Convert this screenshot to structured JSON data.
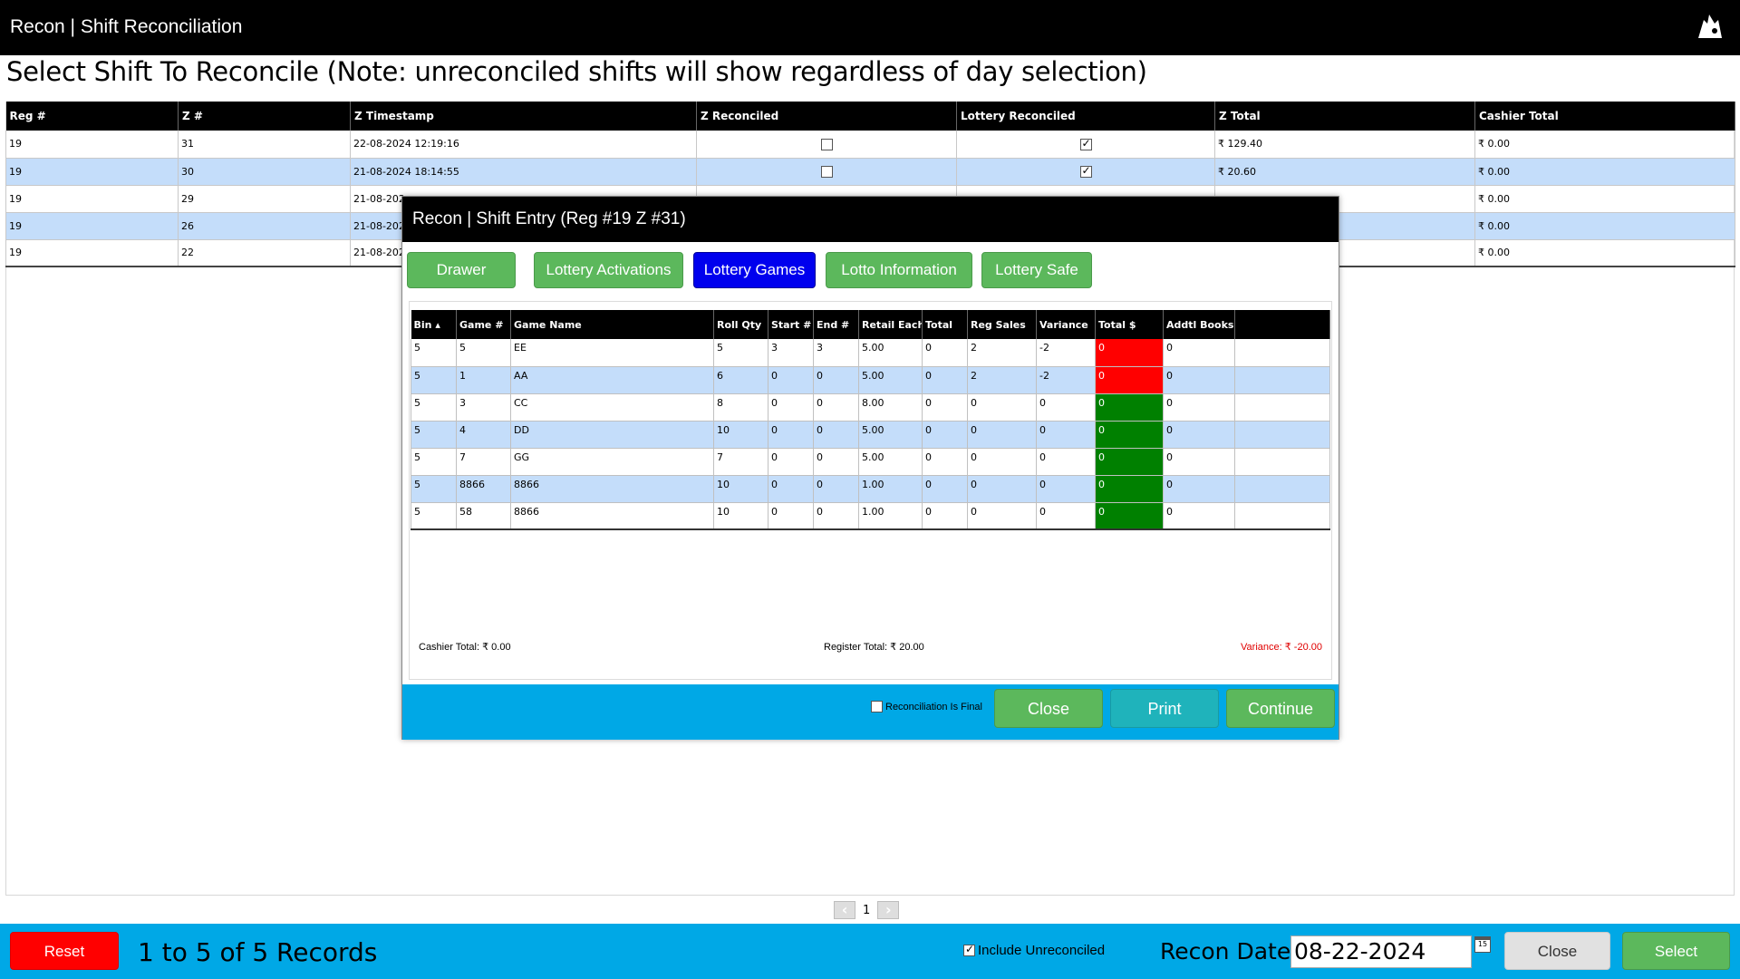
{
  "window": {
    "title": "Recon | Shift Reconciliation",
    "logo_icon": "cap-logo-icon"
  },
  "heading": "Select Shift To Reconcile (Note: unreconciled shifts will show regardless of day selection)",
  "main_table": {
    "headers": [
      "Reg #",
      "Z #",
      "Z Timestamp",
      "Z Reconciled",
      "Lottery Reconciled",
      "Z Total",
      "Cashier Total"
    ],
    "rows": [
      {
        "reg": "19",
        "z": "31",
        "timestamp": "22-08-2024 12:19:16",
        "z_reconciled": false,
        "lottery_reconciled": true,
        "z_total": "₹ 129.40",
        "cashier_total": "₹ 0.00"
      },
      {
        "reg": "19",
        "z": "30",
        "timestamp": "21-08-2024 18:14:55",
        "z_reconciled": false,
        "lottery_reconciled": true,
        "z_total": "₹ 20.60",
        "cashier_total": "₹ 0.00"
      },
      {
        "reg": "19",
        "z": "29",
        "timestamp": "21-08-202",
        "z_reconciled": null,
        "lottery_reconciled": null,
        "z_total": "",
        "cashier_total": "₹ 0.00"
      },
      {
        "reg": "19",
        "z": "26",
        "timestamp": "21-08-202",
        "z_reconciled": null,
        "lottery_reconciled": null,
        "z_total": "",
        "cashier_total": "₹ 0.00"
      },
      {
        "reg": "19",
        "z": "22",
        "timestamp": "21-08-202",
        "z_reconciled": null,
        "lottery_reconciled": null,
        "z_total": "",
        "cashier_total": "₹ 0.00"
      }
    ]
  },
  "pager": {
    "prev_icon": "chevron-left-icon",
    "page": "1",
    "next_icon": "chevron-right-icon"
  },
  "footer": {
    "reset_label": "Reset",
    "records_text": "1 to 5 of 5 Records",
    "include_unreconciled_label": "Include Unreconciled",
    "include_unreconciled_checked": true,
    "recon_date_label": "Recon Date :",
    "recon_date_value": "08-22-2024",
    "calendar_icon": "calendar-icon",
    "calendar_text": "15",
    "close_label": "Close",
    "select_label": "Select"
  },
  "modal": {
    "title": "Recon | Shift Entry  (Reg #19  Z #31)",
    "tabs": [
      {
        "label": "Drawer",
        "active": false
      },
      {
        "label": "Lottery Activations",
        "active": false
      },
      {
        "label": "Lottery Games",
        "active": true
      },
      {
        "label": "Lotto Information",
        "active": false
      },
      {
        "label": "Lottery Safe",
        "active": false
      }
    ],
    "games_table": {
      "headers": [
        "Bin ▴",
        "Game #",
        "Game Name",
        "Roll Qty",
        "Start #",
        "End #",
        "Retail Each",
        "Total",
        "Reg Sales",
        "Variance",
        "Total $",
        "Addtl Books",
        ""
      ],
      "rows": [
        {
          "bin": "5",
          "game": "5",
          "name": "EE",
          "roll": "5",
          "start": "3",
          "end": "3",
          "retail": "5.00",
          "total": "0",
          "reg_sales": "2",
          "variance": "-2",
          "total_usd": "0",
          "addtl": "0",
          "status": "red"
        },
        {
          "bin": "5",
          "game": "1",
          "name": "AA",
          "roll": "6",
          "start": "0",
          "end": "0",
          "retail": "5.00",
          "total": "0",
          "reg_sales": "2",
          "variance": "-2",
          "total_usd": "0",
          "addtl": "0",
          "status": "red"
        },
        {
          "bin": "5",
          "game": "3",
          "name": "CC",
          "roll": "8",
          "start": "0",
          "end": "0",
          "retail": "8.00",
          "total": "0",
          "reg_sales": "0",
          "variance": "0",
          "total_usd": "0",
          "addtl": "0",
          "status": "green"
        },
        {
          "bin": "5",
          "game": "4",
          "name": "DD",
          "roll": "10",
          "start": "0",
          "end": "0",
          "retail": "5.00",
          "total": "0",
          "reg_sales": "0",
          "variance": "0",
          "total_usd": "0",
          "addtl": "0",
          "status": "green"
        },
        {
          "bin": "5",
          "game": "7",
          "name": "GG",
          "roll": "7",
          "start": "0",
          "end": "0",
          "retail": "5.00",
          "total": "0",
          "reg_sales": "0",
          "variance": "0",
          "total_usd": "0",
          "addtl": "0",
          "status": "green"
        },
        {
          "bin": "5",
          "game": "8866",
          "name": "8866",
          "roll": "10",
          "start": "0",
          "end": "0",
          "retail": "1.00",
          "total": "0",
          "reg_sales": "0",
          "variance": "0",
          "total_usd": "0",
          "addtl": "0",
          "status": "green"
        },
        {
          "bin": "5",
          "game": "58",
          "name": "8866",
          "roll": "10",
          "start": "0",
          "end": "0",
          "retail": "1.00",
          "total": "0",
          "reg_sales": "0",
          "variance": "0",
          "total_usd": "0",
          "addtl": "0",
          "status": "green"
        }
      ]
    },
    "cashier_total": "Cashier Total: ₹ 0.00",
    "register_total": "Register Total: ₹ 20.00",
    "variance": "Variance: ₹ -20.00",
    "final_label": "Reconciliation Is Final",
    "final_checked": false,
    "close_label": "Close",
    "print_label": "Print",
    "continue_label": "Continue"
  },
  "colors": {
    "accent_bar": "#00a8e6",
    "alt_row": "#c4ddfa",
    "green": "#5cb85c",
    "red": "#ff0000",
    "active_tab": "#0000ee",
    "teal": "#1fb3bb"
  }
}
